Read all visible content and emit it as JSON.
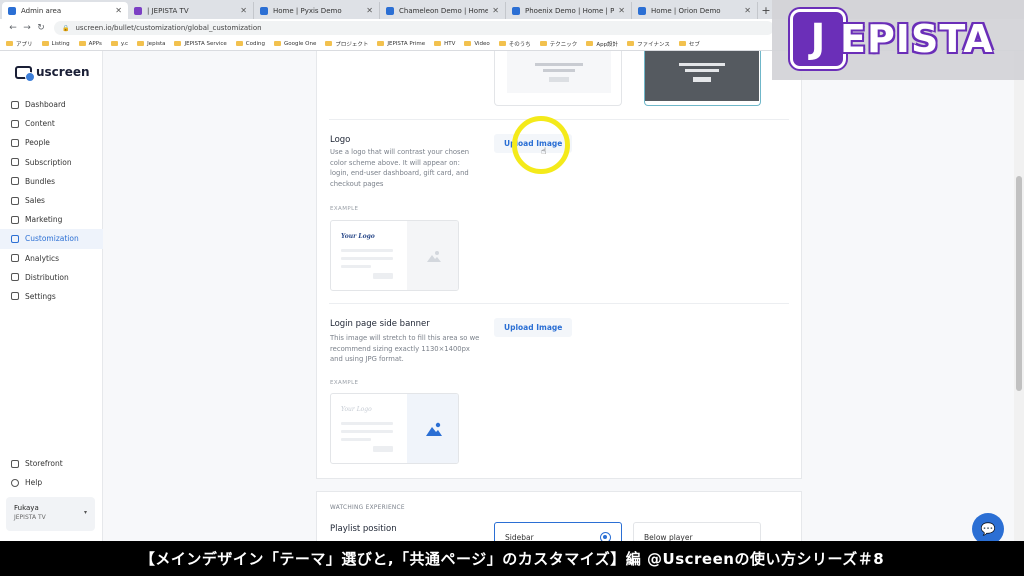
{
  "browser": {
    "tabs": [
      {
        "label": "Admin area",
        "color": "#2b6fd4",
        "active": true
      },
      {
        "label": "| JEPISTA TV",
        "color": "#7b3fc4",
        "active": false
      },
      {
        "label": "Home | Pyxis Demo",
        "color": "#2b6fd4",
        "active": false
      },
      {
        "label": "Chameleon Demo | Home",
        "color": "#2b6fd4",
        "active": false
      },
      {
        "label": "Phoenix Demo | Home | Phoenix",
        "color": "#2b6fd4",
        "active": false
      },
      {
        "label": "Home | Orion Demo",
        "color": "#2b6fd4",
        "active": false
      }
    ],
    "url": "uscreen.io/bullet/customization/global_customization",
    "bookmarks": [
      "アプリ",
      "Listing",
      "APPs",
      "y.c",
      "Jepista",
      "JEPISTA Service",
      "Coding",
      "Google One",
      "プロジェクト",
      "JEPISTA Prime",
      "HTV",
      "Video",
      "そのうち",
      "テクニック",
      "App設計",
      "ファイナンス",
      "セブ"
    ]
  },
  "sidebar": {
    "brand": "uscreen",
    "items": [
      {
        "label": "Dashboard",
        "active": false
      },
      {
        "label": "Content",
        "active": false
      },
      {
        "label": "People",
        "active": false
      },
      {
        "label": "Subscription",
        "active": false
      },
      {
        "label": "Bundles",
        "active": false
      },
      {
        "label": "Sales",
        "active": false
      },
      {
        "label": "Marketing",
        "active": false
      },
      {
        "label": "Customization",
        "active": true
      },
      {
        "label": "Analytics",
        "active": false
      },
      {
        "label": "Distribution",
        "active": false
      },
      {
        "label": "Settings",
        "active": false
      }
    ],
    "bottom_items": [
      "Storefront",
      "Help"
    ],
    "user": {
      "name": "Fukaya",
      "org": "JEPISTA TV"
    }
  },
  "logo_section": {
    "title": "Logo",
    "description": "Use a logo that will contrast your chosen color scheme above. It will appear on: login, end-user dashboard, gift card, and checkout pages",
    "example_label": "EXAMPLE",
    "example_logo_text": "Your Logo",
    "button": "Upload Image"
  },
  "banner_section": {
    "title": "Login page side banner",
    "description": "This image will stretch to fill this area so we recommend sizing exactly 1130×1400px and using JPG format.",
    "example_label": "EXAMPLE",
    "example_logo_text": "Your Logo",
    "button": "Upload Image"
  },
  "watching": {
    "section_label": "WATCHING EXPERIENCE",
    "playlist_title": "Playlist position",
    "options": [
      {
        "label": "Sidebar",
        "selected": true
      },
      {
        "label": "Below player",
        "selected": false
      }
    ]
  },
  "overlay_logo": {
    "mark": "J",
    "text": "EPISTA"
  },
  "subtitle": "【メインデザイン「テーマ」選びと,「共通ページ」のカスタマイズ】編 @Uscreenの使い方シリーズ＃8",
  "colors": {
    "accent": "#2b6fd4",
    "highlight": "#f4ea1a",
    "brand_purple": "#6b2fb8"
  }
}
